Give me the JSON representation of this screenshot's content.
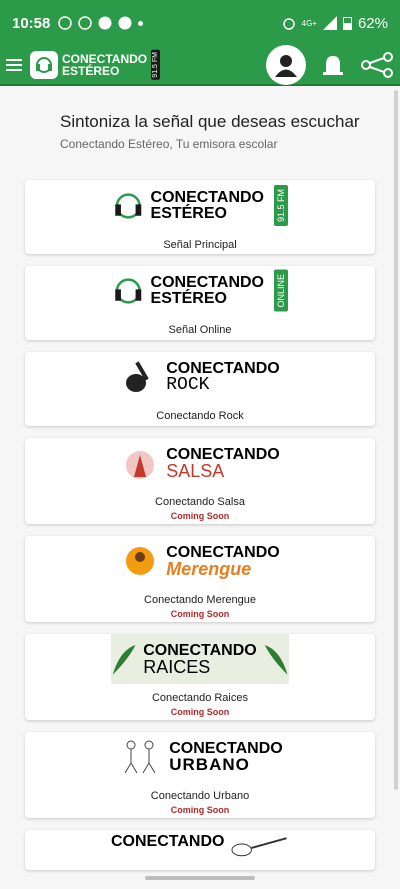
{
  "status": {
    "time": "10:58",
    "battery": "62%",
    "net": "4G+"
  },
  "app": {
    "logo_line1": "CONECTANDO",
    "logo_line2": "ESTÉREO",
    "logo_fm": "91.5 FM"
  },
  "heading": {
    "title": "Sintoniza la señal que deseas escuchar",
    "subtitle": "Conectando Estéreo, Tu emisora escolar"
  },
  "cards": [
    {
      "banner_line1": "CONECTANDO",
      "banner_line2": "ESTÉREO",
      "badge": "91.5 FM",
      "label": "Señal Principal",
      "coming": ""
    },
    {
      "banner_line1": "CONECTANDO",
      "banner_line2": "ESTÉREO",
      "badge": "ONLINE",
      "label": "Señal Online",
      "coming": ""
    },
    {
      "banner_line1": "CONECTANDO",
      "banner_line2": "ROCK",
      "badge": "",
      "label": "Conectando Rock",
      "coming": ""
    },
    {
      "banner_line1": "CONECTANDO",
      "banner_line2": "SALSA",
      "badge": "",
      "label": "Conectando Salsa",
      "coming": "Coming Soon"
    },
    {
      "banner_line1": "CONECTANDO",
      "banner_line2": "Merengue",
      "badge": "",
      "label": "Conectando Merengue",
      "coming": "Coming Soon"
    },
    {
      "banner_line1": "CONECTANDO",
      "banner_line2": "RAICES",
      "badge": "",
      "label": "Conectando Raices",
      "coming": "Coming Soon"
    },
    {
      "banner_line1": "CONECTANDO",
      "banner_line2": "URBANO",
      "badge": "",
      "label": "Conectando Urbano",
      "coming": "Coming Soon"
    },
    {
      "banner_line1": "CONECTANDO",
      "banner_line2": "",
      "badge": "",
      "label": "",
      "coming": ""
    }
  ],
  "colors": {
    "primary": "#2b9a49",
    "coming": "#b22a2a"
  }
}
